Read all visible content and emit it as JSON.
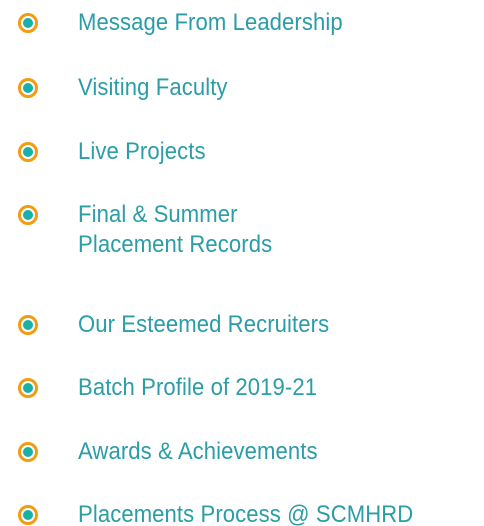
{
  "colors": {
    "bullet_ring": "#f39c12",
    "bullet_dot": "#1ab0a8",
    "link_text": "#2a9da6"
  },
  "menu": {
    "items": [
      {
        "lines": [
          "Message From Leadership"
        ]
      },
      {
        "lines": [
          "Visiting Faculty"
        ]
      },
      {
        "lines": [
          "Live Projects"
        ]
      },
      {
        "lines": [
          "Final & Summer",
          "Placement Records"
        ]
      },
      {
        "lines": [
          "Our Esteemed Recruiters"
        ]
      },
      {
        "lines": [
          "Batch Profile of 2019-21"
        ]
      },
      {
        "lines": [
          "Awards & Achievements"
        ]
      },
      {
        "lines": [
          "Placements Process @ SCMHRD"
        ]
      }
    ]
  }
}
